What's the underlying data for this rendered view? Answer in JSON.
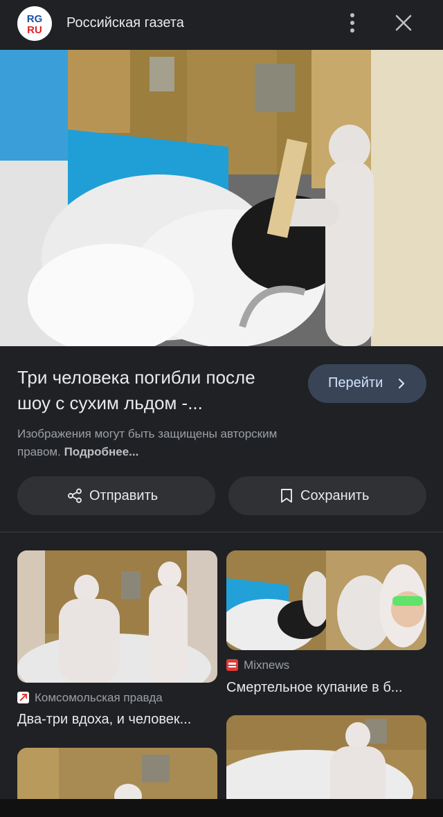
{
  "header": {
    "logo_text_top": "RG",
    "logo_text_bottom": "RU",
    "source_name": "Российская газета"
  },
  "hero": {
    "image_alt": "Люди в защитных костюмах у бассейна с сухим льдом"
  },
  "result": {
    "title_line1": "Три человека погибли после",
    "title_line2": "шоу с сухим льдом -...",
    "go_label": "Перейти",
    "copyright_text": "Изображения могут быть защищены авторским правом.",
    "more_link": "Подробнее..."
  },
  "actions": {
    "share_label": "Отправить",
    "save_label": "Сохранить"
  },
  "related": [
    {
      "source": "Комсомольская правда",
      "title": "Два-три вдоха, и человек...",
      "favicon_color": "#ffffff"
    },
    {
      "source": "Mixnews",
      "title": "Смертельное купание в б...",
      "favicon_color": "#e53935"
    },
    {
      "source": "",
      "title": ""
    },
    {
      "source": "",
      "title": ""
    }
  ],
  "colors": {
    "background": "#202124",
    "button_primary": "#394457",
    "button_secondary": "#303134",
    "logo_red": "#e31e24",
    "logo_blue": "#1e4fa0"
  }
}
